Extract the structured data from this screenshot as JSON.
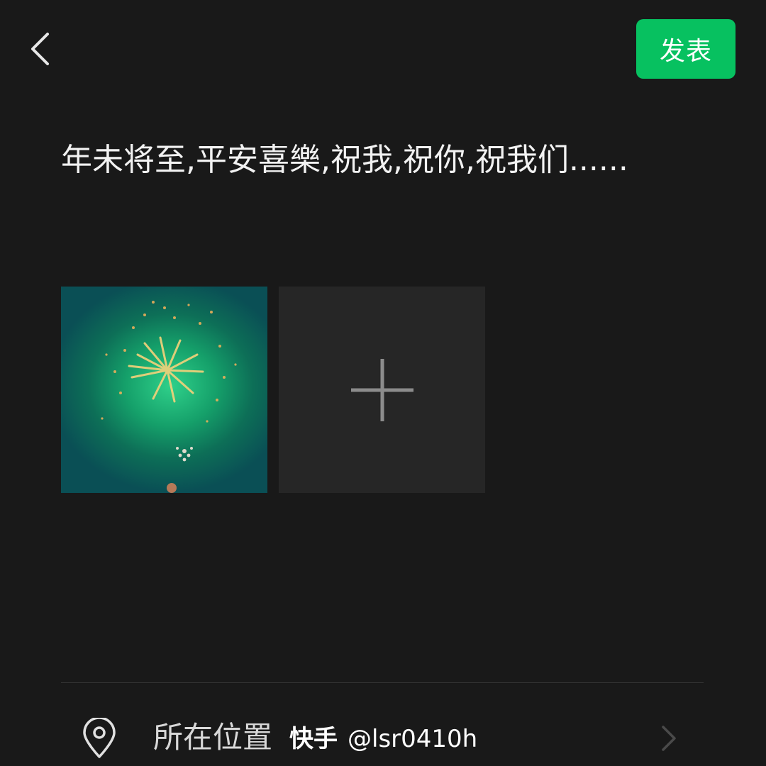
{
  "header": {
    "back_icon": "chevron-left-icon",
    "publish_label": "发表",
    "publish_color": "#07c160"
  },
  "post": {
    "text": "年未将至,平安喜樂,祝我,祝你,祝我们......"
  },
  "media": {
    "photos": [
      {
        "icon": "fireworks-photo"
      }
    ],
    "add_icon": "plus-icon"
  },
  "location": {
    "icon": "location-pin-icon",
    "label": "所在位置",
    "chevron_icon": "chevron-right-icon"
  },
  "watermark": {
    "brand": "快手",
    "handle": "@lsr0410h"
  }
}
